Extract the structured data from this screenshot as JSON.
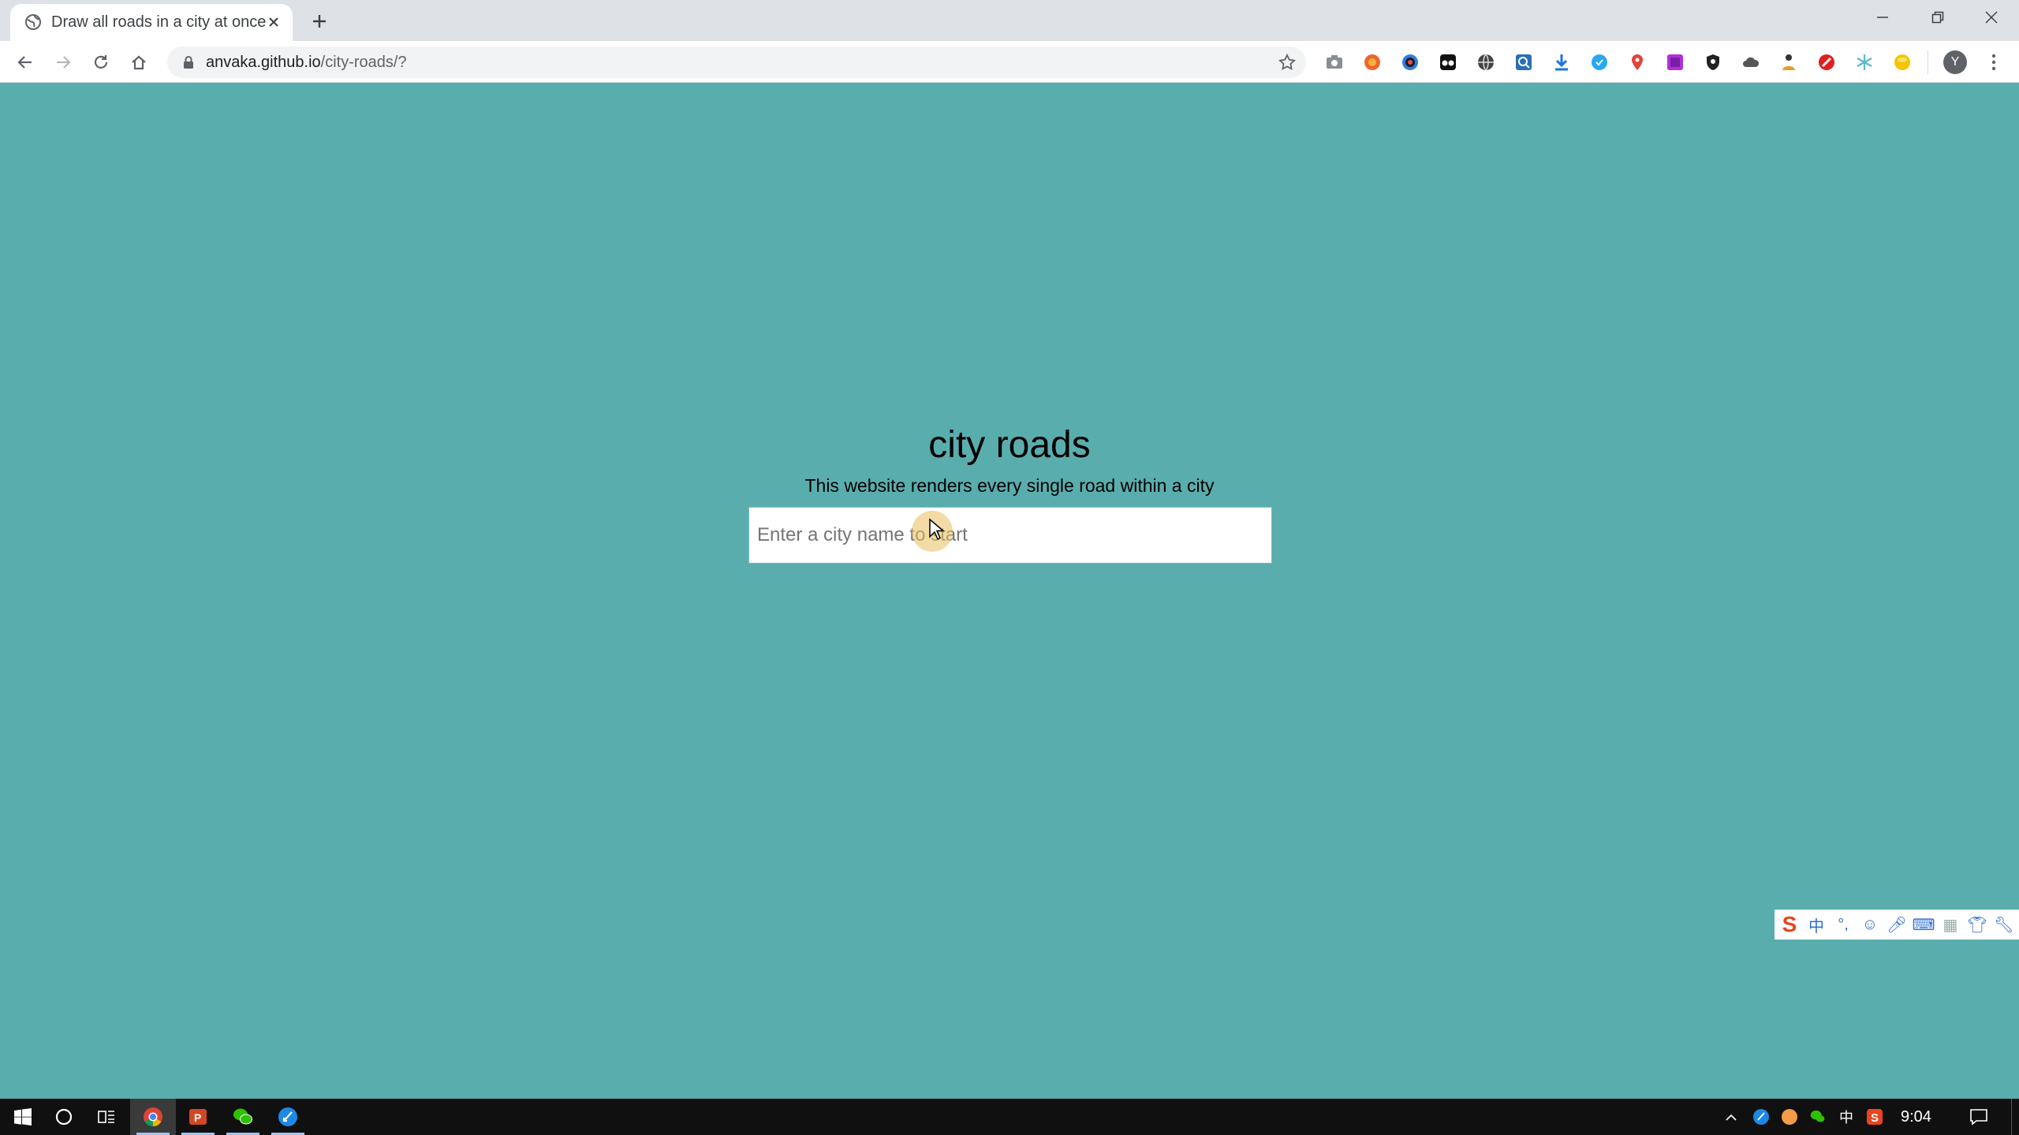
{
  "browser": {
    "tab_title": "Draw all roads in a city at once",
    "url_host": "anvaka.github.io",
    "url_path": "/city-roads/?",
    "profile_initial": "Y"
  },
  "page": {
    "title": "city roads",
    "subtitle": "This website renders every single road within a city",
    "search_placeholder": "Enter a city name to start",
    "background_color": "#5aadad"
  },
  "ime_toolbar": {
    "mode_label": "中",
    "punct_label": "°,"
  },
  "taskbar": {
    "clock": "9:04",
    "tray_lang": "中"
  },
  "extensions": [
    "camera-icon",
    "extension-orange-icon",
    "extension-color-ring-icon",
    "extension-black-icon",
    "extension-globe-icon",
    "extension-search-icon",
    "download-icon",
    "extension-blue-icon",
    "location-pin-icon",
    "extension-purple-icon",
    "extension-shield-icon",
    "extension-cloud-icon",
    "extension-figure-icon",
    "extension-red-icon",
    "extension-snowflake-icon",
    "extension-yellow-icon"
  ]
}
